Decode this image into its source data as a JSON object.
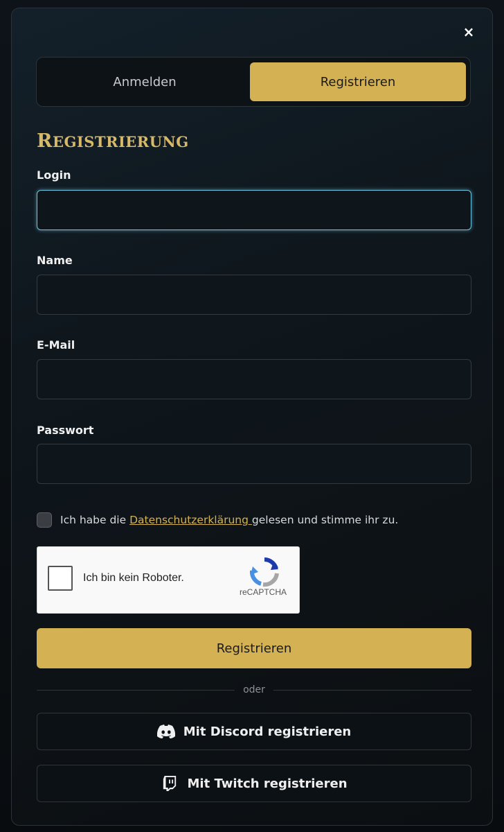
{
  "close_icon": "×",
  "tabs": {
    "login": "Anmelden",
    "register": "Registrieren"
  },
  "heading": {
    "first": "R",
    "rest": "EGISTRIERUNG"
  },
  "fields": {
    "login": {
      "label": "Login",
      "value": ""
    },
    "name": {
      "label": "Name",
      "value": ""
    },
    "email": {
      "label": "E-Mail",
      "value": ""
    },
    "password": {
      "label": "Passwort",
      "value": ""
    }
  },
  "consent": {
    "before": "Ich habe die ",
    "link": "Datenschutzerklärung ",
    "after": "gelesen und stimme ihr zu."
  },
  "recaptcha": {
    "label": "Ich bin kein Roboter.",
    "brand": "reCAPTCHA"
  },
  "submit": "Registrieren",
  "divider": "oder",
  "social": {
    "discord": "Mit Discord registrieren",
    "twitch": "Mit Twitch registrieren"
  },
  "colors": {
    "accent": "#d4b254",
    "focus": "#6fc3df"
  }
}
